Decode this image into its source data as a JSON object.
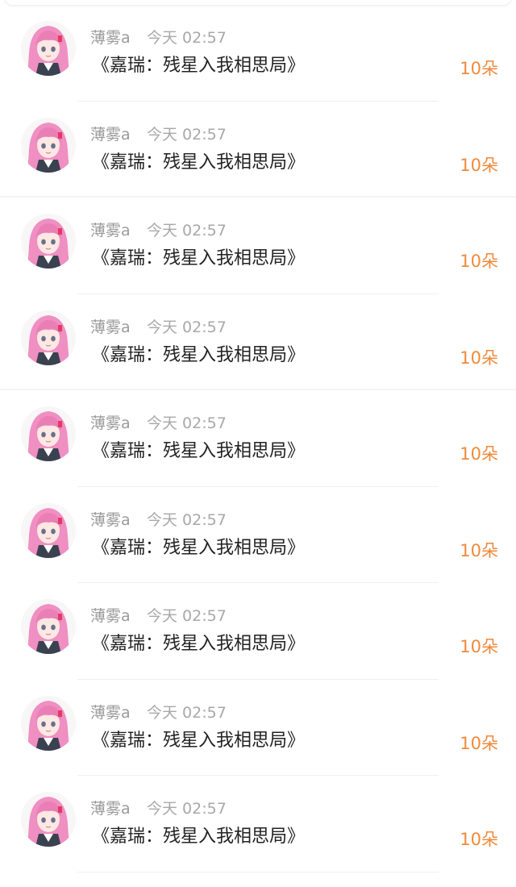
{
  "accent_color": "#ef8a3c",
  "feed": {
    "items": [
      {
        "username": "薄雾a",
        "time": "今天 02:57",
        "book_title": "《嘉瑞：残星入我相思局》",
        "gift": "10朵",
        "avatar_icon": "anime-girl-pink-hair-avatar"
      },
      {
        "username": "薄雾a",
        "time": "今天 02:57",
        "book_title": "《嘉瑞：残星入我相思局》",
        "gift": "10朵",
        "avatar_icon": "anime-girl-pink-hair-avatar"
      },
      {
        "username": "薄雾a",
        "time": "今天 02:57",
        "book_title": "《嘉瑞：残星入我相思局》",
        "gift": "10朵",
        "avatar_icon": "anime-girl-pink-hair-avatar"
      },
      {
        "username": "薄雾a",
        "time": "今天 02:57",
        "book_title": "《嘉瑞：残星入我相思局》",
        "gift": "10朵",
        "avatar_icon": "anime-girl-pink-hair-avatar"
      },
      {
        "username": "薄雾a",
        "time": "今天 02:57",
        "book_title": "《嘉瑞：残星入我相思局》",
        "gift": "10朵",
        "avatar_icon": "anime-girl-pink-hair-avatar"
      },
      {
        "username": "薄雾a",
        "time": "今天 02:57",
        "book_title": "《嘉瑞：残星入我相思局》",
        "gift": "10朵",
        "avatar_icon": "anime-girl-pink-hair-avatar"
      },
      {
        "username": "薄雾a",
        "time": "今天 02:57",
        "book_title": "《嘉瑞：残星入我相思局》",
        "gift": "10朵",
        "avatar_icon": "anime-girl-pink-hair-avatar"
      },
      {
        "username": "薄雾a",
        "time": "今天 02:57",
        "book_title": "《嘉瑞：残星入我相思局》",
        "gift": "10朵",
        "avatar_icon": "anime-girl-pink-hair-avatar"
      },
      {
        "username": "薄雾a",
        "time": "今天 02:57",
        "book_title": "《嘉瑞：残星入我相思局》",
        "gift": "10朵",
        "avatar_icon": "anime-girl-pink-hair-avatar"
      }
    ]
  }
}
